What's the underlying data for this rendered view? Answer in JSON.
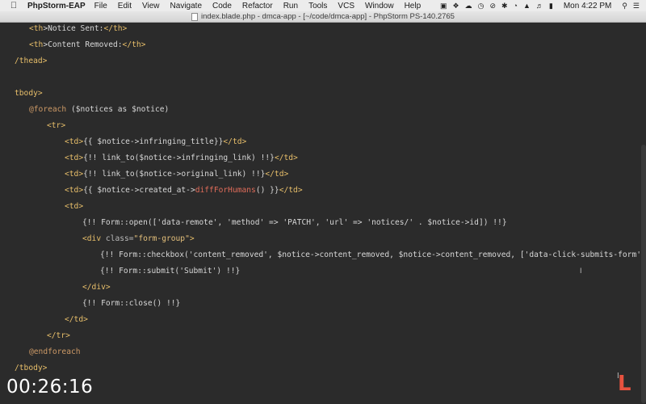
{
  "menubar": {
    "apple_icon": "apple-icon",
    "app_name": "PhpStorm-EAP",
    "menus": [
      "File",
      "Edit",
      "View",
      "Navigate",
      "Code",
      "Refactor",
      "Run",
      "Tools",
      "VCS",
      "Window",
      "Help"
    ],
    "clock": "Mon 4:22 PM",
    "tray_icons": [
      "lock-icon",
      "dropbox-icon",
      "cloud-icon",
      "history-icon",
      "stop-icon",
      "bluetooth-icon",
      "time-machine-icon",
      "wifi-icon",
      "volume-icon",
      "battery-icon",
      "search-icon",
      "list-icon"
    ]
  },
  "window": {
    "title": "index.blade.php - dmca-app - [~/code/dmca-app] - PhpStorm PS-140.2765"
  },
  "code": {
    "lines": [
      {
        "indent": 36,
        "parts": [
          {
            "t": "<",
            "c": "tag"
          },
          {
            "t": "th",
            "c": "tag"
          },
          {
            "t": ">Notice Sent:",
            "c": "txt"
          },
          {
            "t": "</th>",
            "c": "tag"
          }
        ]
      },
      {
        "indent": 36,
        "parts": [
          {
            "t": "<",
            "c": "tag"
          },
          {
            "t": "th",
            "c": "tag"
          },
          {
            "t": ">Content Removed:",
            "c": "txt"
          },
          {
            "t": "</th>",
            "c": "tag"
          }
        ]
      },
      {
        "indent": 18,
        "parts": [
          {
            "t": "/thead>",
            "c": "tag"
          }
        ]
      },
      {
        "indent": 18,
        "parts": []
      },
      {
        "indent": 18,
        "parts": [
          {
            "t": "tbody>",
            "c": "tag"
          }
        ]
      },
      {
        "indent": 36,
        "parts": [
          {
            "t": "@foreach",
            "c": "dir"
          },
          {
            "t": " (",
            "c": "php"
          },
          {
            "t": "$notices",
            "c": "var"
          },
          {
            "t": " as ",
            "c": "php"
          },
          {
            "t": "$notice",
            "c": "var"
          },
          {
            "t": ")",
            "c": "php"
          }
        ]
      },
      {
        "indent": 58,
        "parts": [
          {
            "t": "<tr>",
            "c": "tag"
          }
        ]
      },
      {
        "indent": 80,
        "parts": [
          {
            "t": "<td>",
            "c": "tag"
          },
          {
            "t": "{{ $notice->infringing_title}}",
            "c": "php"
          },
          {
            "t": "</td>",
            "c": "tag"
          }
        ]
      },
      {
        "indent": 80,
        "parts": [
          {
            "t": "<td>",
            "c": "tag"
          },
          {
            "t": "{!! link_to($notice->infringing_link) !!}",
            "c": "php"
          },
          {
            "t": "</td>",
            "c": "tag"
          }
        ]
      },
      {
        "indent": 80,
        "parts": [
          {
            "t": "<td>",
            "c": "tag"
          },
          {
            "t": "{!! link_to($notice->original_link) !!}",
            "c": "php"
          },
          {
            "t": "</td>",
            "c": "tag"
          }
        ]
      },
      {
        "indent": 80,
        "parts": [
          {
            "t": "<td>",
            "c": "tag"
          },
          {
            "t": "{{ $notice->created_at->",
            "c": "php"
          },
          {
            "t": "diffForHumans",
            "c": "method"
          },
          {
            "t": "() }}",
            "c": "php"
          },
          {
            "t": "</td>",
            "c": "tag"
          }
        ]
      },
      {
        "indent": 80,
        "parts": [
          {
            "t": "<td>",
            "c": "tag"
          }
        ]
      },
      {
        "indent": 102,
        "parts": [
          {
            "t": "{!! Form::open(['data-remote', 'method' => 'PATCH', 'url' => 'notices/' . $notice->id]) !!}",
            "c": "php"
          }
        ]
      },
      {
        "indent": 102,
        "parts": [
          {
            "t": "<div ",
            "c": "tag"
          },
          {
            "t": "class=",
            "c": "attr"
          },
          {
            "t": "\"form-group\"",
            "c": "str"
          },
          {
            "t": ">",
            "c": "tag"
          }
        ]
      },
      {
        "indent": 124,
        "parts": [
          {
            "t": "{!! Form::checkbox('content_removed', $notice->content_removed, $notice->content_removed, ['data-click-submits-form']) !",
            "c": "php"
          }
        ]
      },
      {
        "indent": 124,
        "parts": [
          {
            "t": "{!! Form::submit('Submit') !!}",
            "c": "php"
          }
        ]
      },
      {
        "indent": 102,
        "parts": [
          {
            "t": "</div>",
            "c": "tag"
          }
        ]
      },
      {
        "indent": 102,
        "parts": [
          {
            "t": "{!! Form::close() !!}",
            "c": "php"
          }
        ]
      },
      {
        "indent": 80,
        "parts": [
          {
            "t": "</td>",
            "c": "tag"
          }
        ]
      },
      {
        "indent": 58,
        "parts": [
          {
            "t": "</tr>",
            "c": "tag"
          }
        ]
      },
      {
        "indent": 36,
        "parts": [
          {
            "t": "@endforeach",
            "c": "dir"
          }
        ]
      },
      {
        "indent": 18,
        "parts": [
          {
            "t": "/tbody>",
            "c": "tag"
          }
        ]
      }
    ]
  },
  "video": {
    "timestamp": "00:26:16",
    "logo_letter": "L"
  }
}
